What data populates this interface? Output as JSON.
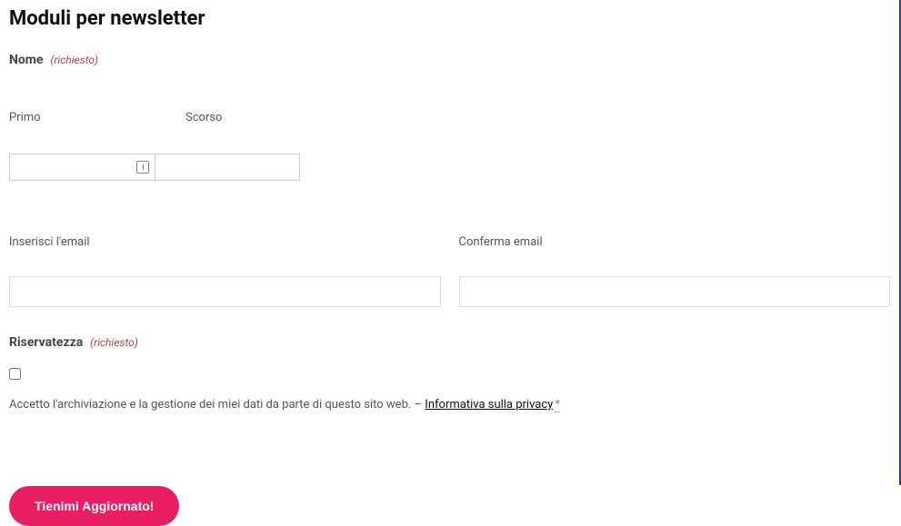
{
  "title": "Moduli per newsletter",
  "name_section": {
    "label": "Nome",
    "required": "(richiesto)",
    "first_label": "Primo",
    "last_label": "Scorso"
  },
  "email_section": {
    "enter_label": "Inserisci l'email",
    "confirm_label": "Conferma email"
  },
  "privacy_section": {
    "label": "Riservatezza",
    "required": "(richiesto)",
    "consent_text": "Accetto l'archiviazione e la gestione dei miei dati da parte di questo sito web. – ",
    "link_text": "Informativa sulla privacy",
    "asterisk": "*"
  },
  "submit_label": "Tienimi Aggiornato!"
}
